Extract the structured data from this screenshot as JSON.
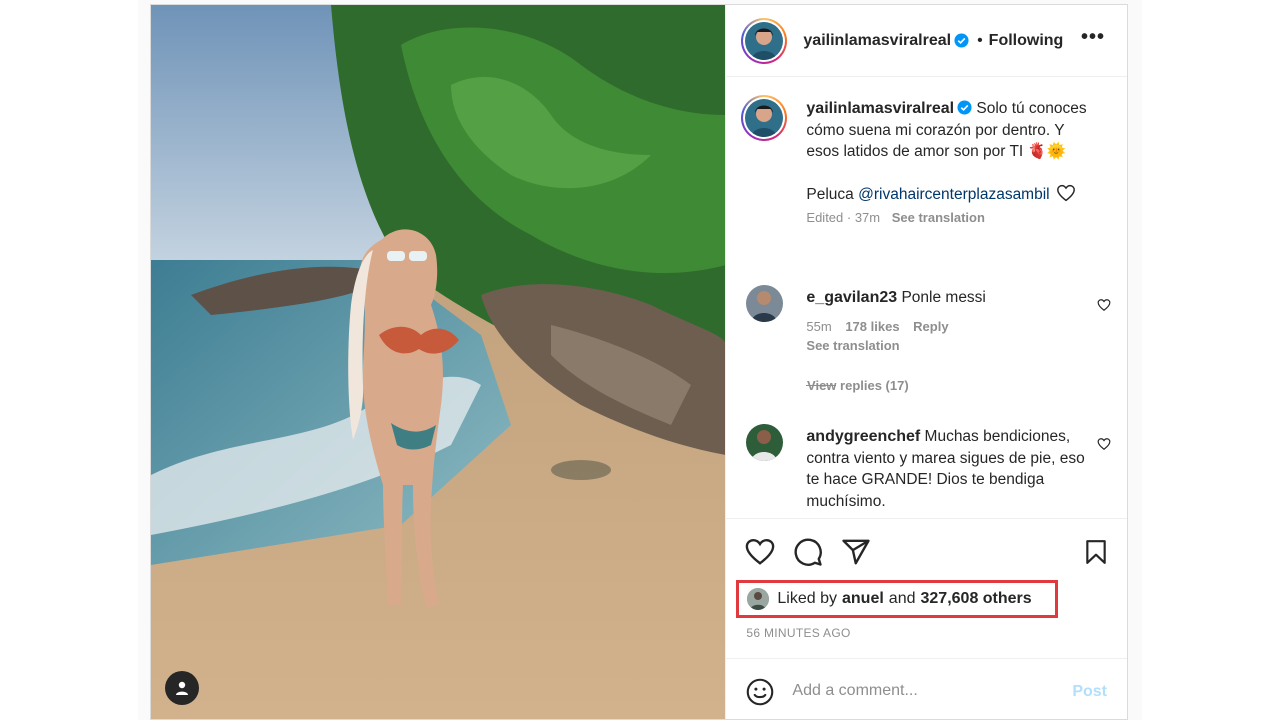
{
  "post": {
    "username": "yailinlamasviralreal",
    "dot": "•",
    "follow_status": "Following",
    "more_label": "•••",
    "caption_line": "Solo tú conoces cómo suena mi corazón por dentro. Y esos latidos de amor son por TI 🫀🌞",
    "caption_mention_prefix": "Peluca",
    "caption_mention": "@rivahaircenterplazasambil",
    "caption_meta": "Edited · 37m",
    "see_translation": "See translation"
  },
  "comments": [
    {
      "username": "e_gavilan23",
      "text": "Ponle messi",
      "time": "55m",
      "likes": "178 likes",
      "reply": "Reply",
      "see_translation": "See translation",
      "view_replies": "View replies (17)"
    },
    {
      "username": "andygreenchef",
      "text": "Muchas bendiciones, contra viento y marea sigues de pie, eso te hace GRANDE! Dios te bendiga muchísimo."
    }
  ],
  "likes": {
    "prefix": "Liked by",
    "user": "anuel",
    "and": "and",
    "others": "327,608 others"
  },
  "timestamp": "56 MINUTES AGO",
  "add_comment": {
    "placeholder": "Add a comment...",
    "post_label": "Post"
  },
  "colors": {
    "highlight": "#e0393e",
    "verified": "#0095f6",
    "post_disabled": "#b2dffc"
  },
  "icons": [
    "heart-icon",
    "comment-icon",
    "share-icon",
    "bookmark-icon",
    "emoji-icon",
    "user-tag-icon",
    "verified-icon",
    "more-icon"
  ]
}
